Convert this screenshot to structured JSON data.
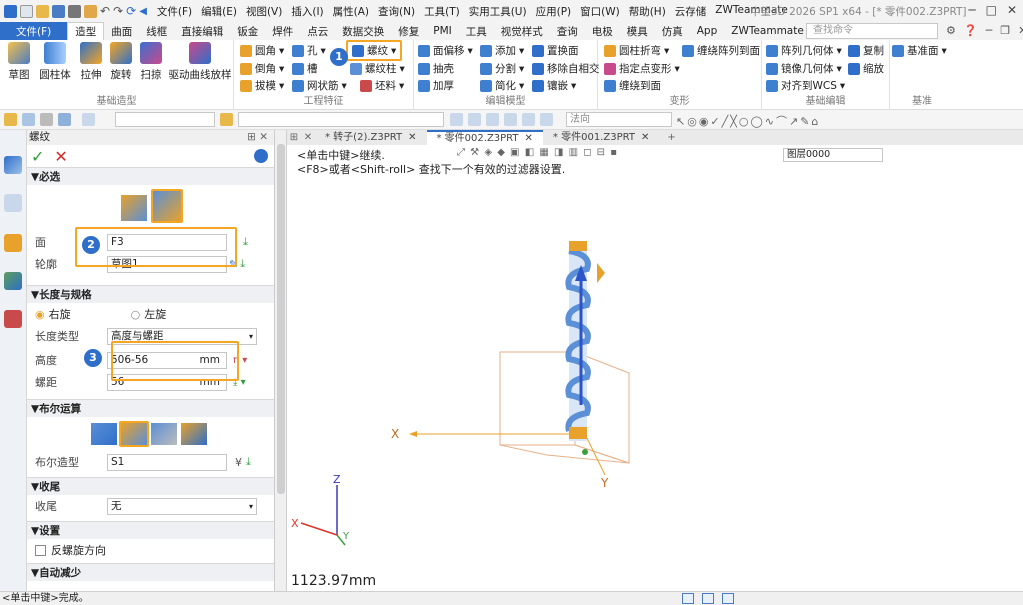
{
  "colors": {
    "accent": "#2f6fc9",
    "highlight": "#f5a623",
    "badge": "#2f6fc9",
    "helix": "#5b8fd6",
    "arrow_blue": "#2b54c8",
    "arrow_orange": "#e8a12a",
    "axis_red": "#e0352b"
  },
  "menubar": {
    "items": [
      "文件(F)",
      "编辑(E)",
      "视图(V)",
      "插入(I)",
      "属性(A)",
      "查询(N)",
      "工具(T)",
      "实用工具(U)",
      "应用(P)",
      "窗口(W)",
      "帮助(H)",
      "云存储",
      "ZWTeammate"
    ],
    "app_title": "中望3D 2026 SP1 x64 - [* 零件002.Z3PRT]"
  },
  "tabs": {
    "file": "文件(F)",
    "items": [
      "造型",
      "曲面",
      "线框",
      "直接编辑",
      "钣金",
      "焊件",
      "点云",
      "数据交换",
      "修复",
      "PMI",
      "工具",
      "视觉样式",
      "查询",
      "电极",
      "模具",
      "仿真",
      "App",
      "ZWTeammate"
    ],
    "search_placeholder": "查找命令"
  },
  "ribbon": {
    "basic": {
      "name": "基础造型",
      "buttons": [
        "草图",
        "圆柱体",
        "拉伸",
        "旋转",
        "扫掠",
        "驱动曲线放样"
      ]
    },
    "feature": {
      "name": "工程特征",
      "items": [
        "圆角",
        "孔",
        "螺纹",
        "倒角",
        "槽",
        "螺纹柱",
        "拔模",
        "网状筋",
        "坯料"
      ]
    },
    "editmodel": {
      "name": "编辑模型",
      "items": [
        "面偏移",
        "添加",
        "置换面",
        "抽壳",
        "分割",
        "移除自相交",
        "加厚",
        "简化",
        "镶嵌"
      ]
    },
    "deform": {
      "name": "变形",
      "items": [
        "圆柱折弯",
        "缠绕阵列到面",
        "指定点变形",
        "缠绕到面"
      ]
    },
    "basicedit": {
      "name": "基础编辑",
      "items": [
        "阵列几何体",
        "复制",
        "镜像几何体",
        "缩放",
        "对齐到WCS"
      ]
    },
    "datum": {
      "name": "基准",
      "items": [
        "基准面"
      ]
    }
  },
  "toolbar": {
    "filter_combo": "法向",
    "layer_combo": "图层0000"
  },
  "panel": {
    "title": "螺纹",
    "required": {
      "label": "必选",
      "face_label": "面",
      "face_value": "F3",
      "profile_label": "轮廓",
      "profile_value": "草图1"
    },
    "length": {
      "label": "长度与规格",
      "right_hand": "右旋",
      "left_hand": "左旋",
      "length_type_label": "长度类型",
      "length_type_value": "高度与螺距",
      "height_label": "高度",
      "height_value": "506-56",
      "height_unit": "mm",
      "pitch_label": "螺距",
      "pitch_value": "56",
      "pitch_unit": "mm"
    },
    "boolean": {
      "label": "布尔运算",
      "shape_label": "布尔造型",
      "shape_value": "S1"
    },
    "end": {
      "label": "收尾",
      "end_label": "收尾",
      "end_value": "无"
    },
    "settings": {
      "label": "设置",
      "reverse_label": "反螺旋方向"
    },
    "auto": {
      "label": "自动减少"
    }
  },
  "doctabs": [
    "* 转子(2).Z3PRT",
    "* 零件002.Z3PRT",
    "* 零件001.Z3PRT"
  ],
  "viewport": {
    "hint1": "<单击中键>继续.",
    "hint2": "<F8>或者<Shift-roll> 查找下一个有效的过滤器设置.",
    "dimension": "1123.97mm",
    "axis_x": "X",
    "axis_y": "Y",
    "axis_z": "Z"
  },
  "badges": [
    "1",
    "2",
    "3"
  ],
  "status": {
    "text": "<单击中键>完成。"
  }
}
